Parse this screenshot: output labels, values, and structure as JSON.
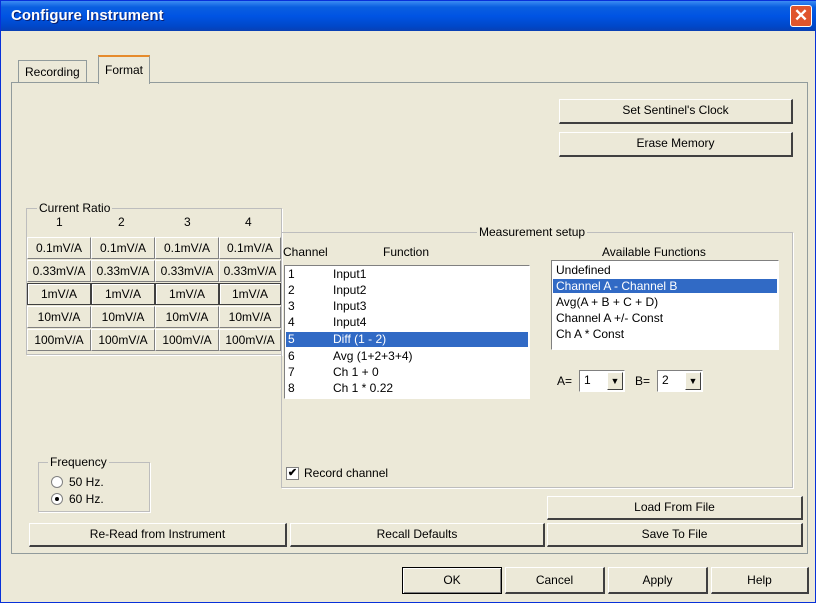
{
  "window": {
    "title": "Configure Instrument",
    "close_glyph": "✕"
  },
  "tabs": [
    {
      "label": "Recording"
    },
    {
      "label": "Format"
    }
  ],
  "buttons": {
    "set_clock": "Set Sentinel's Clock",
    "erase_memory": "Erase Memory",
    "load_from_file": "Load From File",
    "save_to_file": "Save To File",
    "reread": "Re-Read from Instrument",
    "recall_defaults": "Recall Defaults",
    "ok": "OK",
    "cancel": "Cancel",
    "apply": "Apply",
    "help": "Help"
  },
  "current_ratio": {
    "legend": "Current Ratio",
    "columns": [
      "1",
      "2",
      "3",
      "4"
    ],
    "rows": [
      [
        "0.1mV/A",
        "0.1mV/A",
        "0.1mV/A",
        "0.1mV/A"
      ],
      [
        "0.33mV/A",
        "0.33mV/A",
        "0.33mV/A",
        "0.33mV/A"
      ],
      [
        "1mV/A",
        "1mV/A",
        "1mV/A",
        "1mV/A"
      ],
      [
        "10mV/A",
        "10mV/A",
        "10mV/A",
        "10mV/A"
      ],
      [
        "100mV/A",
        "100mV/A",
        "100mV/A",
        "100mV/A"
      ]
    ],
    "selected_row": 2
  },
  "frequency": {
    "legend": "Frequency",
    "options": [
      "50 Hz.",
      "60 Hz."
    ],
    "selected": "60 Hz."
  },
  "measurement": {
    "legend": "Measurement setup",
    "channel_header": "Channel",
    "function_header": "Function",
    "channels": [
      {
        "num": "1",
        "fn": "Input1"
      },
      {
        "num": "2",
        "fn": "Input2"
      },
      {
        "num": "3",
        "fn": "Input3"
      },
      {
        "num": "4",
        "fn": "Input4"
      },
      {
        "num": "5",
        "fn": "Diff (1 - 2)"
      },
      {
        "num": "6",
        "fn": "Avg (1+2+3+4)"
      },
      {
        "num": "7",
        "fn": "Ch 1 + 0"
      },
      {
        "num": "8",
        "fn": "Ch 1 * 0.22"
      }
    ],
    "selected_channel": "5",
    "available_header": "Available Functions",
    "available": [
      "Undefined",
      "Channel A - Channel B",
      "Avg(A + B + C + D)",
      "Channel A +/- Const",
      "Ch A * Const"
    ],
    "selected_available": "Channel A - Channel B",
    "a_label": "A=",
    "a_value": "1",
    "b_label": "B=",
    "b_value": "2",
    "record_channel_label": "Record channel",
    "record_channel_checked": true
  },
  "icons": {
    "dropdown": "chevron-down-icon",
    "check": "checkmark-icon"
  },
  "colors": {
    "title_blue": "#0054e3",
    "selection": "#316ac5",
    "close_red": "#e0552d"
  }
}
